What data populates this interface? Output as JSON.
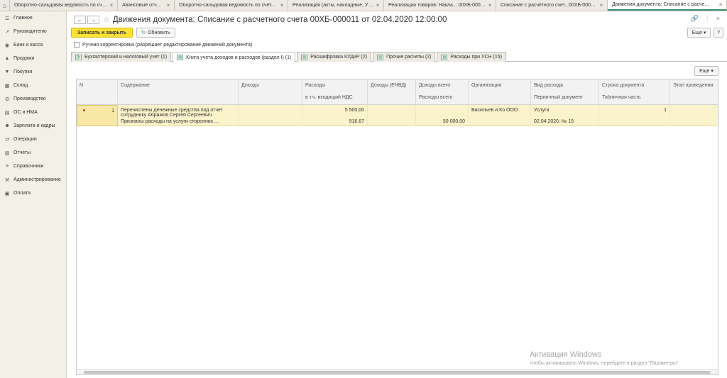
{
  "tabs": [
    {
      "label": "Оборотно-сальдовая ведомость по счет...",
      "close": "×",
      "active": false
    },
    {
      "label": "Авансовые отчеты",
      "close": "×",
      "active": false
    },
    {
      "label": "Оборотно-сальдовая ведомость по счет...",
      "close": "×",
      "active": false
    },
    {
      "label": "Реализация (акты, накладные, УПД)",
      "close": "×",
      "active": false
    },
    {
      "label": "Реализация товаров: Накла... 00ХБ-000010",
      "close": "×",
      "active": false
    },
    {
      "label": "Списание с расчетного счет...00ХБ-000011",
      "close": "×",
      "active": false
    },
    {
      "label": "Движения документа: Списание с расче...",
      "close": "×",
      "active": true
    }
  ],
  "sidebar": {
    "items": [
      {
        "icon": "menu-icon",
        "glyph": "☰",
        "label": "Главное"
      },
      {
        "icon": "chart-line-icon",
        "glyph": "↗",
        "label": "Руководителю"
      },
      {
        "icon": "bank-icon",
        "glyph": "◉",
        "label": "Банк и касса"
      },
      {
        "icon": "sales-icon",
        "glyph": "▲",
        "label": "Продажи"
      },
      {
        "icon": "cart-icon",
        "glyph": "▼",
        "label": "Покупки"
      },
      {
        "icon": "warehouse-icon",
        "glyph": "▦",
        "label": "Склад"
      },
      {
        "icon": "production-icon",
        "glyph": "⚙",
        "label": "Производство"
      },
      {
        "icon": "assets-icon",
        "glyph": "▤",
        "label": "ОС и НМА"
      },
      {
        "icon": "salary-icon",
        "glyph": "☻",
        "label": "Зарплата и кадры"
      },
      {
        "icon": "operations-icon",
        "glyph": "⇄",
        "label": "Операции"
      },
      {
        "icon": "reports-icon",
        "glyph": "▥",
        "label": "Отчеты"
      },
      {
        "icon": "directory-icon",
        "glyph": "≡",
        "label": "Справочники"
      },
      {
        "icon": "admin-icon",
        "glyph": "⚒",
        "label": "Администрирование"
      },
      {
        "icon": "payment-icon",
        "glyph": "▣",
        "label": "Оплата"
      }
    ]
  },
  "header": {
    "back": "←",
    "forward": "→",
    "star": "☆",
    "title": "Движения документа: Списание с расчетного счета 00ХБ-000011 от 02.04.2020 12:00:00",
    "link_icon": "🔗",
    "more_icon": "⋮",
    "close_icon": "×"
  },
  "toolbar": {
    "save_close": "Записать и закрыть",
    "refresh": "Обновить",
    "refresh_icon": "↻",
    "more": "Еще ▾",
    "help": "?"
  },
  "manual": {
    "label": "Ручная корректировка (разрешает редактирование движений документа)"
  },
  "doc_tabs": [
    {
      "label": "Бухгалтерский и налоговый учет (1)",
      "icon": "Дт",
      "active": false
    },
    {
      "label": "Книга учета доходов и расходов (раздел I) (1)",
      "icon": "▤",
      "active": true
    },
    {
      "label": "Расшифровка КУДиР (2)",
      "icon": "▤",
      "active": false
    },
    {
      "label": "Прочие расчеты (2)",
      "icon": "▤",
      "active": false
    },
    {
      "label": "Расходы при УСН (15)",
      "icon": "▤",
      "active": false
    }
  ],
  "grid_more": "Еще ▾",
  "table": {
    "columns": [
      {
        "h1": "N",
        "h2": ""
      },
      {
        "h1": "Содержание",
        "h2": ""
      },
      {
        "h1": "Доходы",
        "h2": ""
      },
      {
        "h1": "Расходы",
        "h2": "в т.ч. входящий НДС"
      },
      {
        "h1": "Доходы (ЕНВД)",
        "h2": ""
      },
      {
        "h1": "Доходы всего",
        "h2": "Расходы всего"
      },
      {
        "h1": "Организация",
        "h2": ""
      },
      {
        "h1": "Вид расхода",
        "h2": "Первичный документ"
      },
      {
        "h1": "Строка документа",
        "h2": "Табличная часть"
      },
      {
        "h1": "Этап проведения",
        "h2": ""
      }
    ],
    "row": {
      "n": "1",
      "content1": "Перечислены денежные средства под отчет",
      "content2": "сотруднику Абрамов Сергей Сергеевич.",
      "content3": "Признаны расходы на услуги сторонних ...",
      "expenses": "5 500,00",
      "vat": "916,67",
      "total_expenses": "50 000,00",
      "org": "Васильев и Ко ООО",
      "expense_type": "Услуги",
      "primary_doc": "02.04.2020, № 15",
      "doc_line": "1"
    }
  },
  "watermark": {
    "line1": "Активация Windows",
    "line2": "Чтобы активировать Windows, перейдите в раздел \"Параметры\"."
  }
}
